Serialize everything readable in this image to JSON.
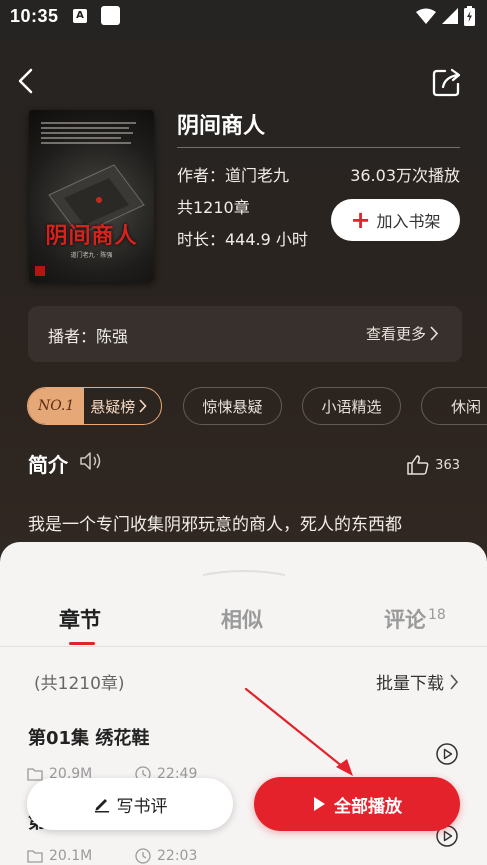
{
  "status_bar": {
    "time": "10:35",
    "a_glyph": "A"
  },
  "book": {
    "title": "阴间商人",
    "cover_title": "阴间商人",
    "cover_small": "道门老九 · 陈强",
    "author": "作者：道门老九",
    "plays": "36.03万次播放",
    "chapters": "共1210章",
    "duration": "时长：444.9 小时",
    "add_shelf_label": "加入书架"
  },
  "narrator": {
    "label": "播者：陈强",
    "more_label": "查看更多"
  },
  "tags": {
    "rank_no": "NO.1",
    "rank_label": "悬疑榜",
    "items": [
      "惊悚悬疑",
      "小语精选",
      "休闲"
    ]
  },
  "intro": {
    "heading": "简介",
    "likes": "363",
    "text": "我是一个专门收集阴邪玩意的商人，死人的东西都"
  },
  "tabs": {
    "chapters": "章节",
    "similar": "相似",
    "comments": "评论",
    "comments_count": "18"
  },
  "list": {
    "total": "(共1210章)",
    "batch_download": "批量下载",
    "episodes": [
      {
        "title": "第01集 绣花鞋",
        "size": "20.9M",
        "duration": "22:49"
      },
      {
        "title": "第",
        "size": "20.1M",
        "duration": "22:03"
      }
    ]
  },
  "actions": {
    "write_review": "写书评",
    "play_all": "全部播放"
  },
  "colors": {
    "accent": "#e3222b",
    "rank": "#e7a877"
  },
  "icons": [
    "back-icon",
    "share-icon",
    "plus-icon",
    "chevron-right-icon",
    "speaker-icon",
    "thumb-up-icon",
    "folder-icon",
    "clock-icon",
    "play-circle-icon",
    "pencil-icon",
    "play-icon",
    "wifi-icon",
    "signal-icon",
    "battery-icon"
  ]
}
